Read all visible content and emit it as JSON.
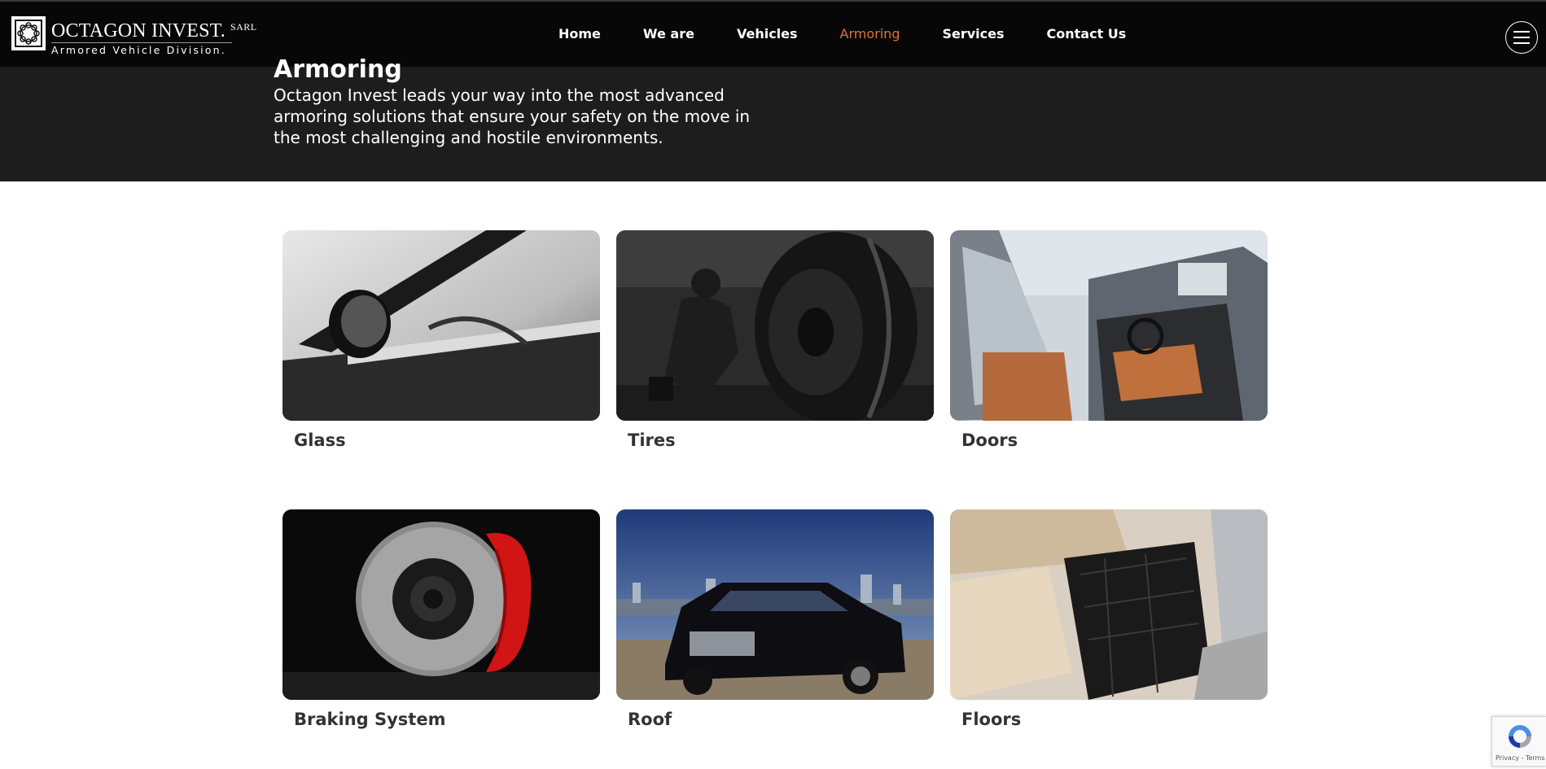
{
  "header": {
    "logo": {
      "title": "OCTAGON INVEST.",
      "suffix": "SARL",
      "subtitle": "Armored Vehicle Division."
    },
    "nav": [
      {
        "label": "Home"
      },
      {
        "label": "We are"
      },
      {
        "label": "Vehicles"
      },
      {
        "label": "Armoring",
        "active": true
      },
      {
        "label": "Services"
      },
      {
        "label": "Contact Us"
      }
    ],
    "menu_icon": "hamburger-menu-icon",
    "active_color": "#e3703a"
  },
  "hero": {
    "title": "Armoring",
    "description": "Octagon Invest leads your way into the most advanced armoring solutions that ensure your safety on the move in the most challenging and hostile environments."
  },
  "cards": [
    {
      "label": "Glass",
      "image": "car side window and mirror (grayscale)"
    },
    {
      "label": "Tires",
      "image": "mechanic with large tire"
    },
    {
      "label": "Doors",
      "image": "open SUV door with tan interior"
    },
    {
      "label": "Braking System",
      "image": "brake disc with red caliper"
    },
    {
      "label": "Roof",
      "image": "black sedan in front of city skyline"
    },
    {
      "label": "Floors",
      "image": "car floor mats and beige seats"
    }
  ],
  "recaptcha": {
    "links": "Privacy - Terms"
  }
}
